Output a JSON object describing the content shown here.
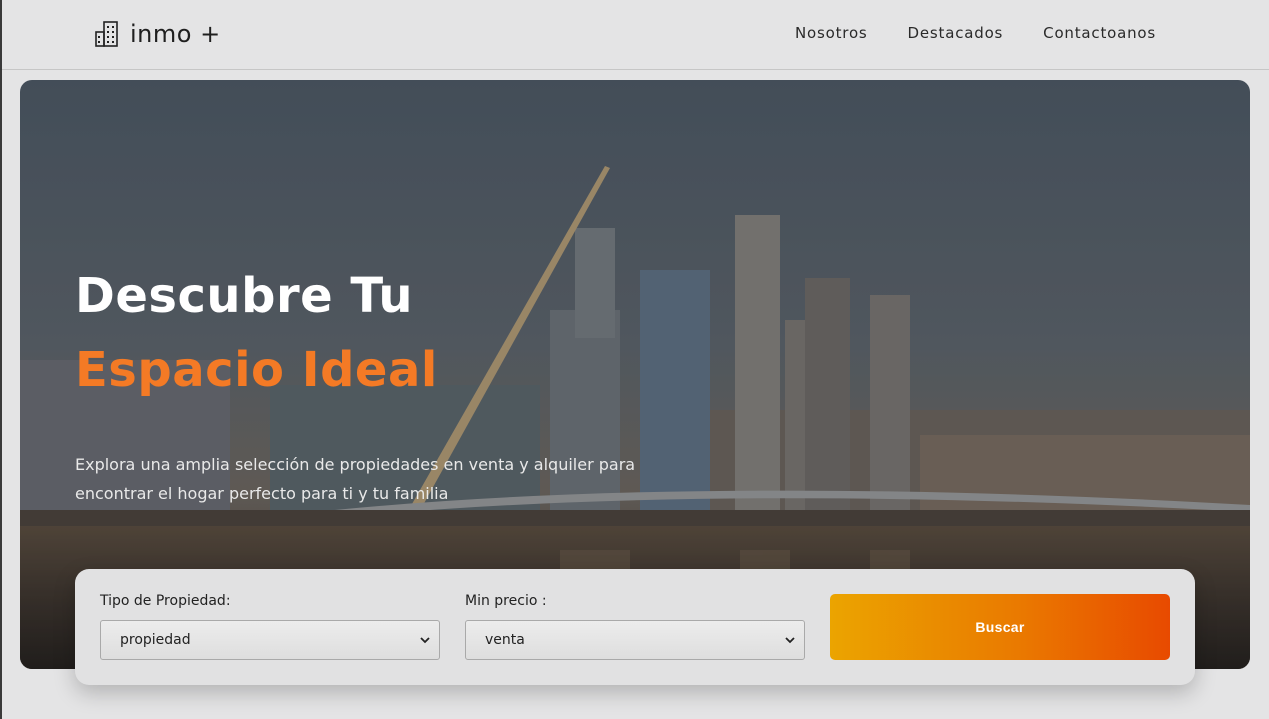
{
  "brand": {
    "name": "inmo +",
    "icon": "building-icon"
  },
  "nav": {
    "items": [
      {
        "label": "Nosotros"
      },
      {
        "label": "Destacados"
      },
      {
        "label": "Contactoanos"
      }
    ]
  },
  "hero": {
    "title_line1": "Descubre Tu",
    "title_line2": "Espacio Ideal",
    "description": "Explora una amplia selección de propiedades en venta y alquiler para encontrar el hogar perfecto para ti y tu familia"
  },
  "search": {
    "property_type": {
      "label": "Tipo de Propiedad:",
      "value": "propiedad"
    },
    "min_price": {
      "label": "Min precio :",
      "value": "venta"
    },
    "button_label": "Buscar"
  },
  "colors": {
    "accent_orange": "#f47a25",
    "button_gradient_start": "#eba400",
    "button_gradient_end": "#e84a00",
    "page_background": "#e4e4e5"
  }
}
